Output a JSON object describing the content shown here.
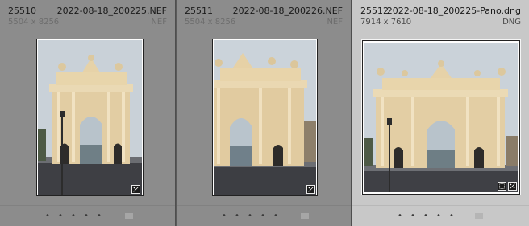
{
  "cells": [
    {
      "index": "25510",
      "filename": "2022-08-18_200225.NEF",
      "dimensions": "5504 x 8256",
      "filetype": "NEF",
      "rating_dots": [
        "•",
        "•",
        "•",
        "•",
        "•"
      ],
      "selected": false,
      "badge_icon": "develop-adjusted-icon"
    },
    {
      "index": "25511",
      "filename": "2022-08-18_200226.NEF",
      "dimensions": "5504 x 8256",
      "filetype": "NEF",
      "rating_dots": [
        "•",
        "•",
        "•",
        "•",
        "•"
      ],
      "selected": false,
      "badge_icon": "develop-adjusted-icon"
    },
    {
      "index": "25512",
      "filename": "2022-08-18_200225-Pano.dng",
      "dimensions": "7914 x 7610",
      "filetype": "DNG",
      "rating_dots": [
        "•",
        "•",
        "•",
        "•",
        "•"
      ],
      "selected": true,
      "badge_icon": "develop-adjusted-icon",
      "extra_badge_icon": "crop-icon"
    }
  ],
  "colors": {
    "cell_bg": "#8c8c8c",
    "selected_cell_bg": "#c8c8c8",
    "sky": "#cfd6de",
    "gate": "#e3cfa6"
  }
}
